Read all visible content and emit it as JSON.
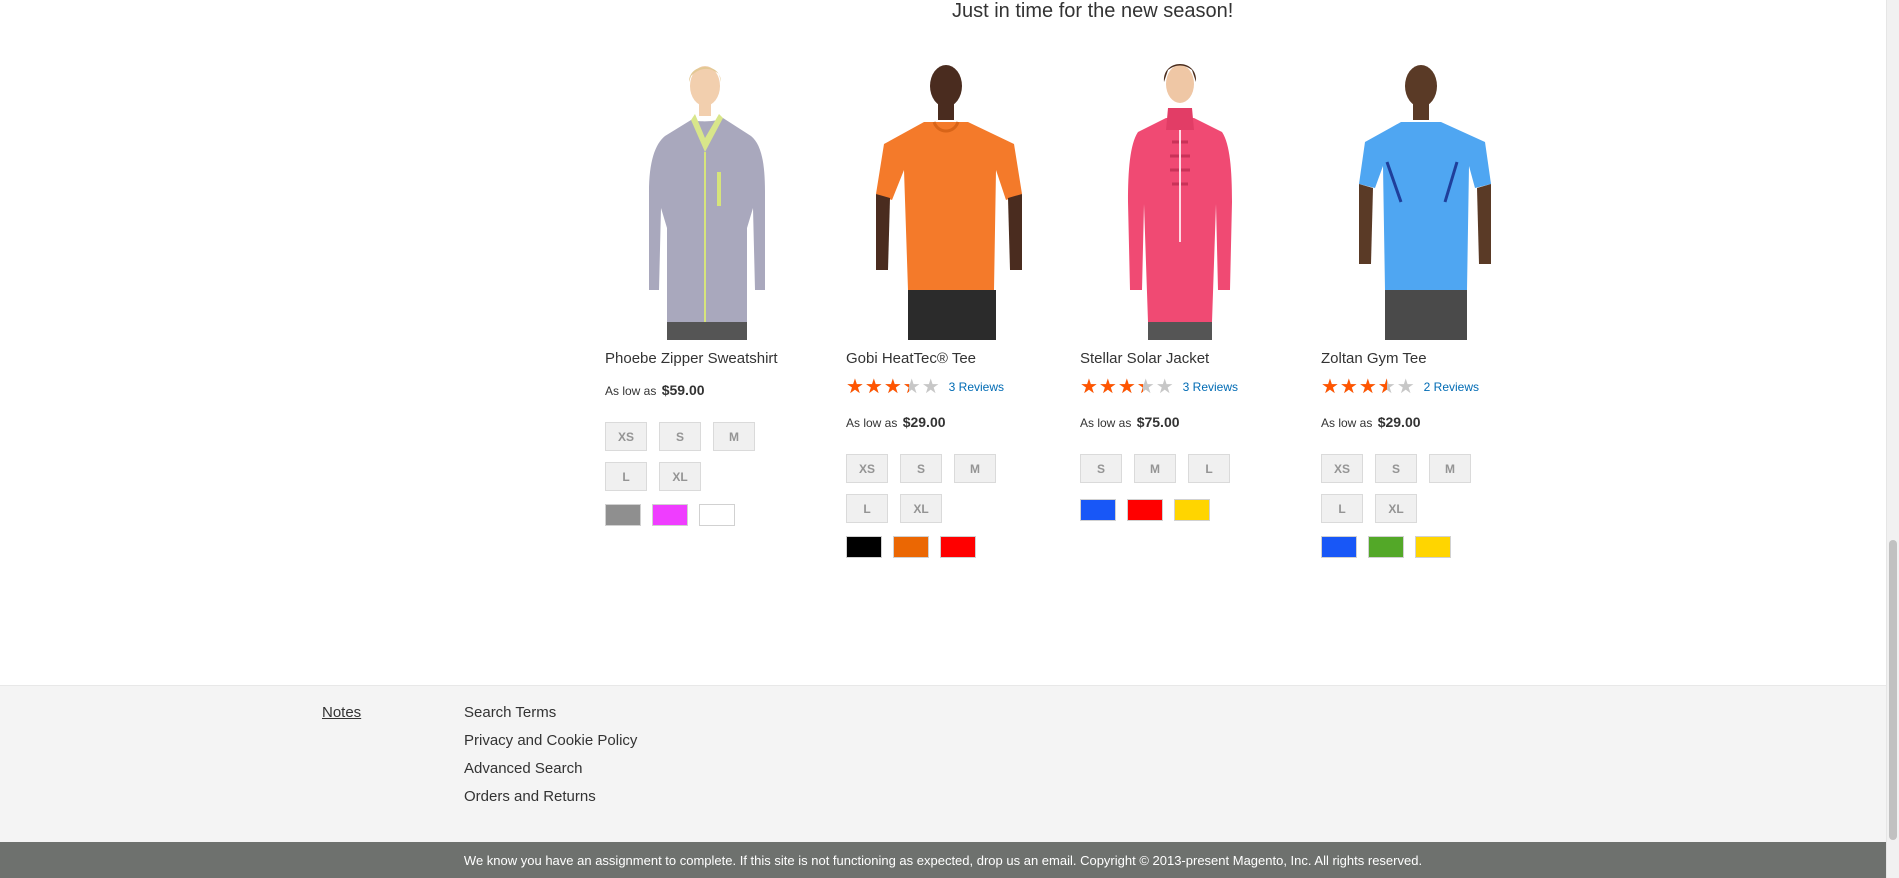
{
  "tagline": "Just in time for the new season!",
  "products": [
    {
      "name": "Phoebe Zipper Sweatshirt",
      "rating_fraction": null,
      "reviews": null,
      "price_prefix": "As low as",
      "price": "$59.00",
      "sizes": [
        "XS",
        "S",
        "M",
        "L",
        "XL"
      ],
      "colors": [
        "#8f8f8f",
        "#ef3dff",
        "#ffffff"
      ]
    },
    {
      "name": "Gobi HeatTec® Tee",
      "rating_fraction": 0.67,
      "reviews": "3 Reviews",
      "price_prefix": "As low as",
      "price": "$29.00",
      "sizes": [
        "XS",
        "S",
        "M",
        "L",
        "XL"
      ],
      "colors": [
        "#000000",
        "#eb6703",
        "#ff0000"
      ]
    },
    {
      "name": "Stellar Solar Jacket",
      "rating_fraction": 0.67,
      "reviews": "3 Reviews",
      "price_prefix": "As low as",
      "price": "$75.00",
      "sizes": [
        "S",
        "M",
        "L"
      ],
      "colors": [
        "#1857f7",
        "#ff0000",
        "#ffd500"
      ]
    },
    {
      "name": "Zoltan Gym Tee",
      "rating_fraction": 0.7,
      "reviews": "2 Reviews",
      "price_prefix": "As low as",
      "price": "$29.00",
      "sizes": [
        "XS",
        "S",
        "M",
        "L",
        "XL"
      ],
      "colors": [
        "#1857f7",
        "#53a828",
        "#ffd500"
      ]
    }
  ],
  "footer": {
    "notes": "Notes",
    "links": [
      "Search Terms",
      "Privacy and Cookie Policy",
      "Advanced Search",
      "Orders and Returns"
    ]
  },
  "copyright": "We know you have an assignment to complete. If this site is not functioning as expected, drop us an email. Copyright © 2013-present Magento, Inc. All rights reserved."
}
